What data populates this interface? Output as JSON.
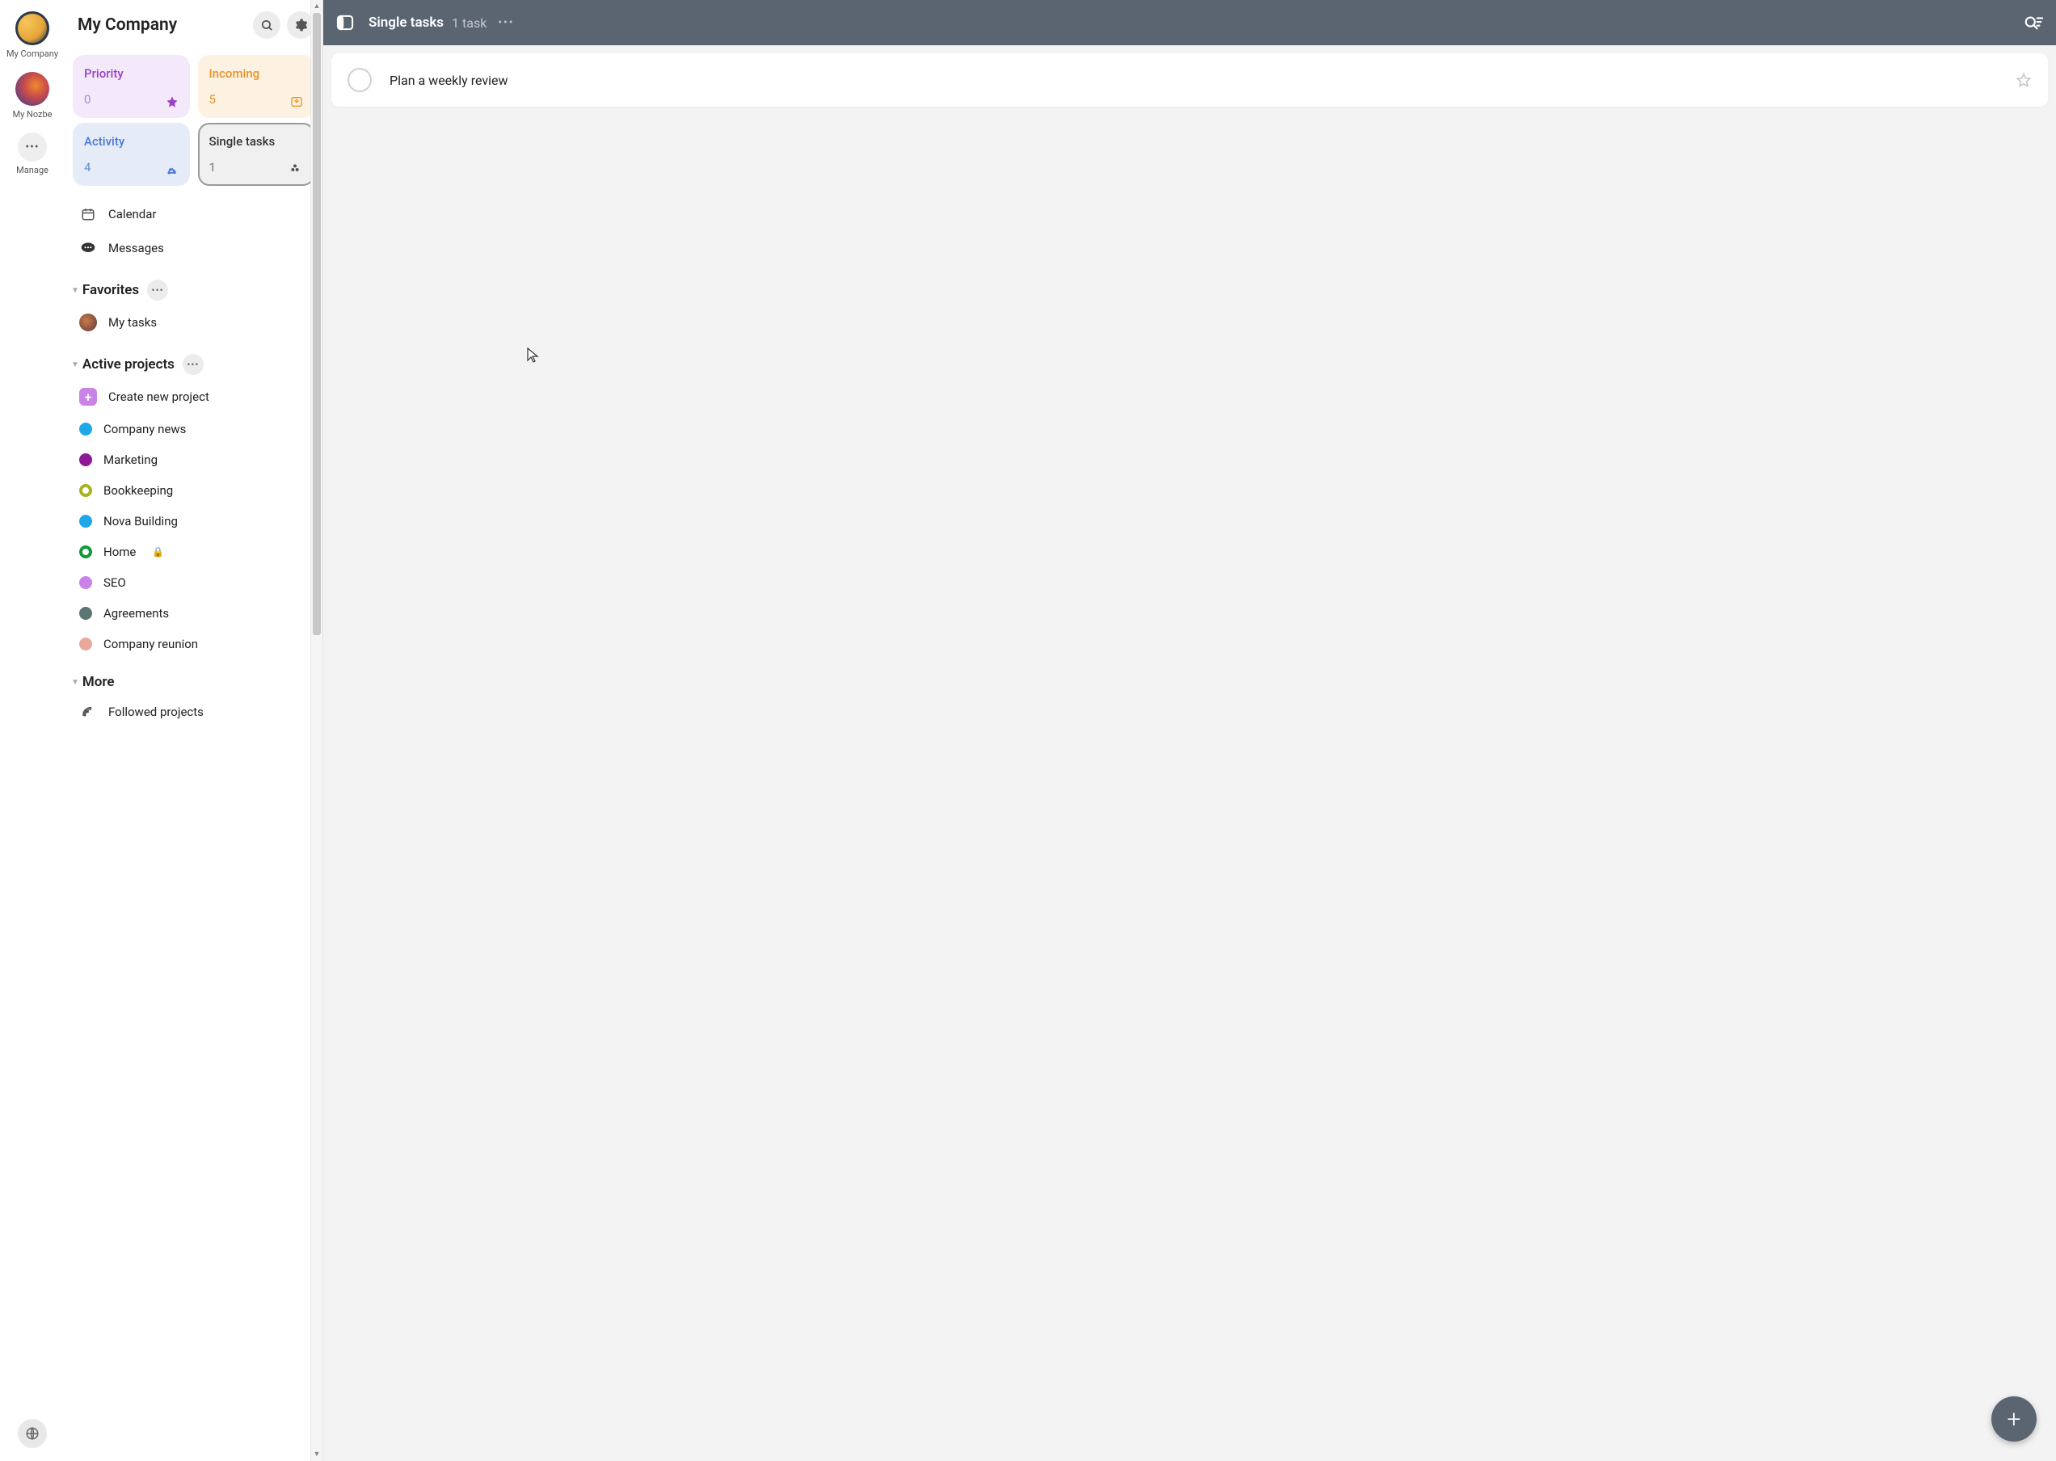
{
  "rail": {
    "workspaces": [
      {
        "id": "company",
        "label": "My Company"
      },
      {
        "id": "mynozbe",
        "label": "My Nozbe"
      }
    ],
    "manage_label": "Manage"
  },
  "sidebar": {
    "title": "My Company",
    "tiles": {
      "priority": {
        "title": "Priority",
        "count": "0"
      },
      "incoming": {
        "title": "Incoming",
        "count": "5"
      },
      "activity": {
        "title": "Activity",
        "count": "4"
      },
      "single": {
        "title": "Single tasks",
        "count": "1"
      }
    },
    "nav": {
      "calendar": "Calendar",
      "messages": "Messages"
    },
    "favorites": {
      "section_label": "Favorites",
      "items": [
        {
          "label": "My tasks"
        }
      ]
    },
    "projects": {
      "section_label": "Active projects",
      "create_label": "Create new project",
      "items": [
        {
          "label": "Company news",
          "color": "#1fa8e8",
          "ring": false
        },
        {
          "label": "Marketing",
          "color": "#8e1996",
          "ring": false
        },
        {
          "label": "Bookkeeping",
          "color": "#a9b21f",
          "ring": true
        },
        {
          "label": "Nova Building",
          "color": "#1fa8e8",
          "ring": false
        },
        {
          "label": "Home",
          "color": "#0f9b3b",
          "ring": true,
          "locked": true
        },
        {
          "label": "SEO",
          "color": "#c983e8",
          "ring": false
        },
        {
          "label": "Agreements",
          "color": "#5b7573",
          "ring": false
        },
        {
          "label": "Company reunion",
          "color": "#e8a89a",
          "ring": false
        }
      ]
    },
    "more": {
      "section_label": "More",
      "followed_label": "Followed projects"
    }
  },
  "main": {
    "header": {
      "title": "Single tasks",
      "subtitle": "1 task"
    },
    "tasks": [
      {
        "title": "Plan a weekly review"
      }
    ]
  }
}
